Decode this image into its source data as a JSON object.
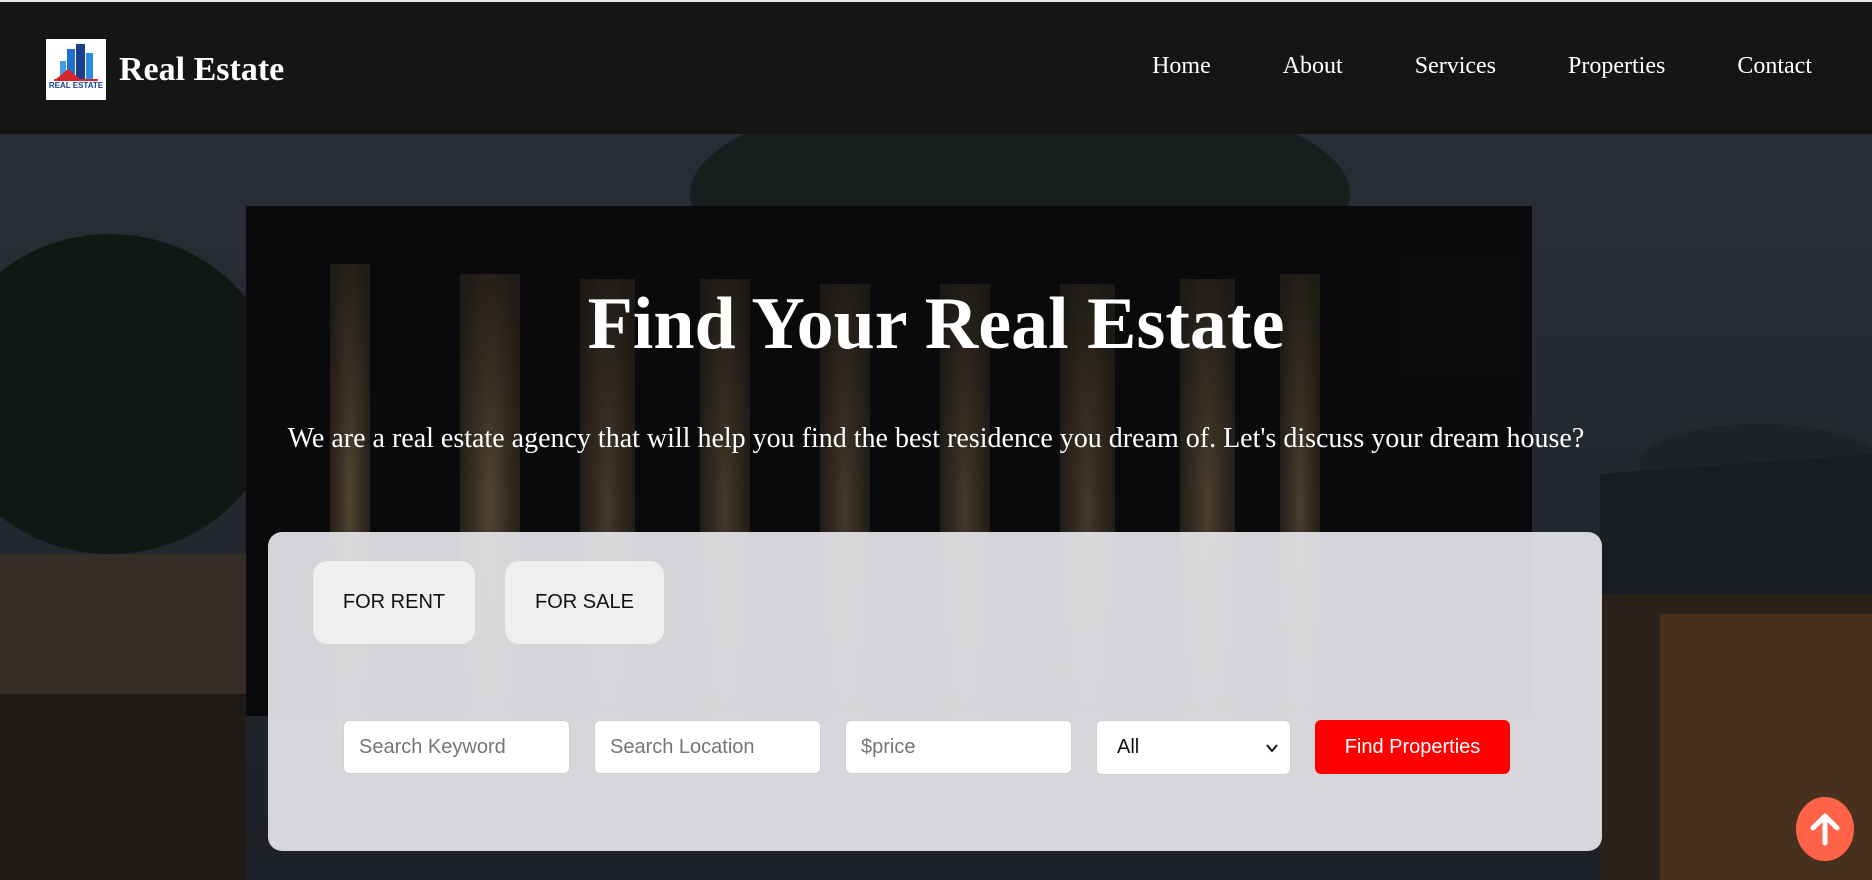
{
  "brand": {
    "name": "Real Estate",
    "logo_text": "REAL ESTATE"
  },
  "nav": {
    "items": [
      "Home",
      "About",
      "Services",
      "Properties",
      "Contact"
    ]
  },
  "hero": {
    "title": "Find Your Real Estate",
    "subtitle": "We are a real estate agency that will help you find the best residence you dream of. Let's discuss your dream house?"
  },
  "search": {
    "tabs": [
      "FOR RENT",
      "FOR SALE"
    ],
    "keyword_placeholder": "Search Keyword",
    "location_placeholder": "Search Location",
    "price_placeholder": "$price",
    "type_selected": "All",
    "submit_label": "Find Properties"
  },
  "icons": {
    "scroll_top": "arrow-up-icon",
    "select_arrow": "chevron-down-icon"
  },
  "colors": {
    "accent": "#ff0000",
    "scroll_top": "#ff6347",
    "navbar": "#151515"
  }
}
